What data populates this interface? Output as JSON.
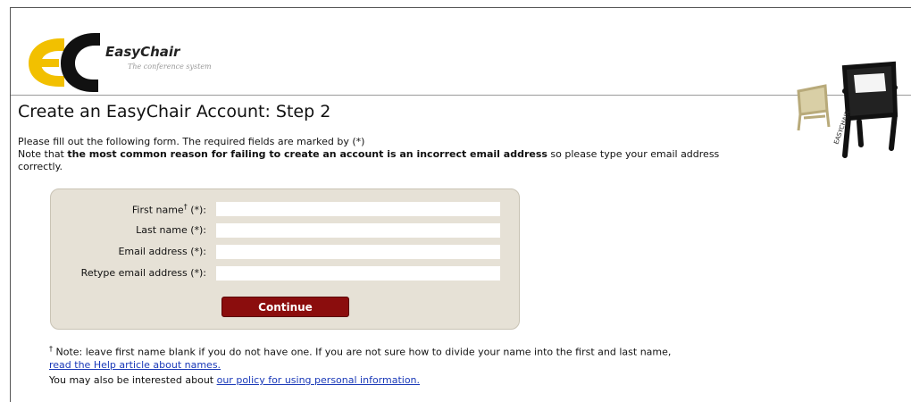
{
  "header": {
    "logo_wordmark": "EasyChair",
    "logo_tagline": "The conference system",
    "page_title": "Create an EasyChair Account: Step 2"
  },
  "intro": {
    "line1": "Please fill out the following form. The required fields are marked by (*)",
    "line2_prefix": "Note that ",
    "line2_bold": "the most common reason for failing to create an account is an incorrect email address",
    "line2_suffix": " so please type your email address correctly."
  },
  "form": {
    "fields": [
      {
        "label": "First name",
        "dagger": "†",
        "required": " (*):",
        "value": ""
      },
      {
        "label": "Last name (*):",
        "value": ""
      },
      {
        "label": "Email address (*):",
        "value": ""
      },
      {
        "label": "Retype email address (*):",
        "value": ""
      }
    ],
    "continue_label": "Continue"
  },
  "footer": {
    "dagger": "†",
    "note_text": " Note: leave first name blank if you do not have one. If you are not sure how to divide your name into the first and last name, ",
    "help_link": "read the Help article about names.",
    "policy_prefix": "You may also be interested about ",
    "policy_link": "our policy for using personal information."
  },
  "colors": {
    "logo_yellow": "#f2c000",
    "logo_black": "#111111",
    "form_bg": "#e6e1d6",
    "button_bg": "#8b0d0d",
    "link": "#1a39b8"
  },
  "icons": [
    "easychair-logo",
    "chair-illustration-icon"
  ]
}
